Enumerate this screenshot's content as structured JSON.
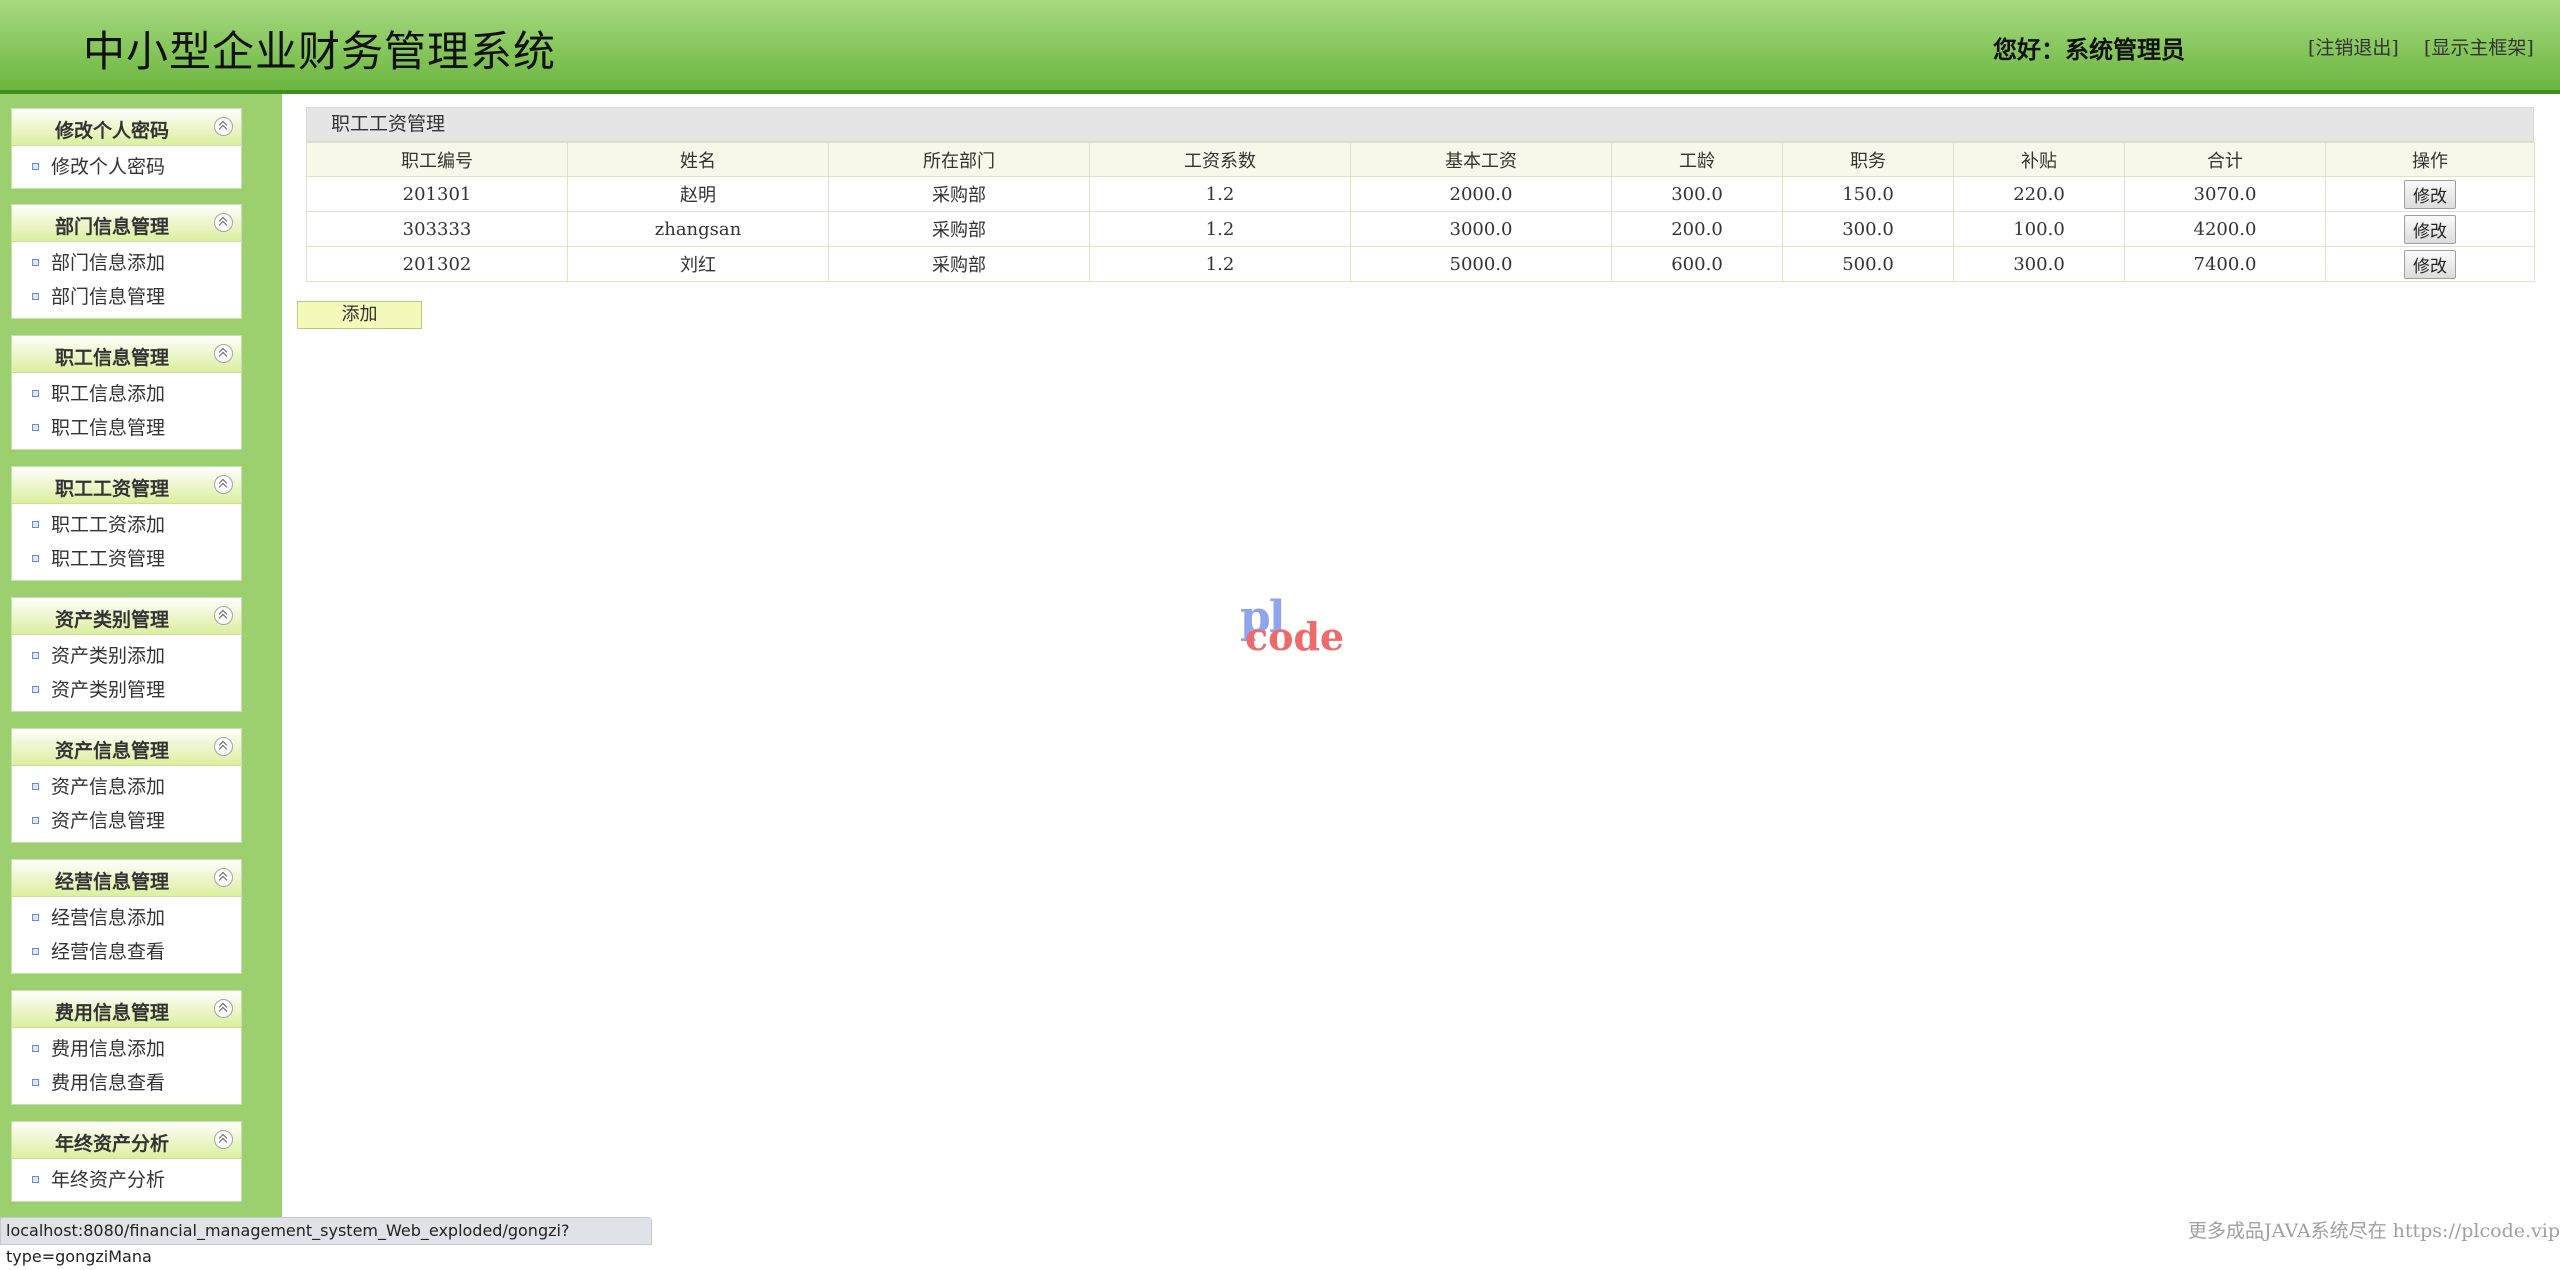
{
  "header": {
    "title": "中小型企业财务管理系统",
    "greeting": "您好：系统管理员",
    "logout": "[注销退出]",
    "show_frame": "[显示主框架]"
  },
  "sidebar": {
    "groups": [
      {
        "title": "修改个人密码",
        "items": [
          "修改个人密码"
        ]
      },
      {
        "title": "部门信息管理",
        "items": [
          "部门信息添加",
          "部门信息管理"
        ]
      },
      {
        "title": "职工信息管理",
        "items": [
          "职工信息添加",
          "职工信息管理"
        ]
      },
      {
        "title": "职工工资管理",
        "items": [
          "职工工资添加",
          "职工工资管理"
        ]
      },
      {
        "title": "资产类别管理",
        "items": [
          "资产类别添加",
          "资产类别管理"
        ]
      },
      {
        "title": "资产信息管理",
        "items": [
          "资产信息添加",
          "资产信息管理"
        ]
      },
      {
        "title": "经营信息管理",
        "items": [
          "经营信息添加",
          "经营信息查看"
        ]
      },
      {
        "title": "费用信息管理",
        "items": [
          "费用信息添加",
          "费用信息查看"
        ]
      },
      {
        "title": "年终资产分析",
        "items": [
          "年终资产分析"
        ]
      }
    ]
  },
  "main": {
    "panel_title": "职工工资管理",
    "columns": [
      "职工编号",
      "姓名",
      "所在部门",
      "工资系数",
      "基本工资",
      "工龄",
      "职务",
      "补贴",
      "合计",
      "操作"
    ],
    "rows": [
      [
        "201301",
        "赵明",
        "采购部",
        "1.2",
        "2000.0",
        "300.0",
        "150.0",
        "220.0",
        "3070.0"
      ],
      [
        "303333",
        "zhangsan",
        "采购部",
        "1.2",
        "3000.0",
        "200.0",
        "300.0",
        "100.0",
        "4200.0"
      ],
      [
        "201302",
        "刘红",
        "采购部",
        "1.2",
        "5000.0",
        "600.0",
        "500.0",
        "300.0",
        "7400.0"
      ]
    ],
    "edit_label": "修改",
    "add_label": "添加"
  },
  "logo": {
    "top": "pl",
    "bottom": "code"
  },
  "status_bar": {
    "url": "localhost:8080/financial_management_system_Web_exploded/gongzi?type=gongziMana"
  },
  "footer_note": "更多成品JAVA系统尽在 https://plcode.vip"
}
